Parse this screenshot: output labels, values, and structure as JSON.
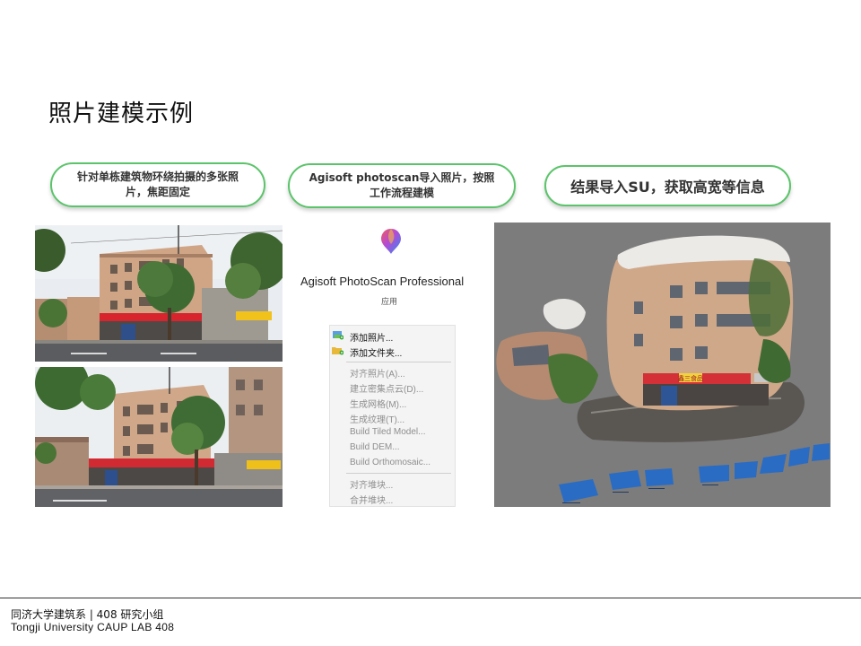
{
  "title": "照片建模示例",
  "steps": [
    {
      "line1": "针对单栋建筑物环绕拍摄的多张照",
      "line2": "片，焦距固定"
    },
    {
      "line1": "Agisoft photoscan导入照片，按照",
      "line2": "工作流程建模"
    },
    {
      "line1": "结果导入SU，获取高宽等信息"
    }
  ],
  "app": {
    "name": "Agisoft PhotoScan Professional",
    "subtitle": "应用"
  },
  "menu": {
    "items": [
      {
        "label": "添加照片...",
        "enabled": true,
        "icon": "add-photo-icon"
      },
      {
        "label": "添加文件夹...",
        "enabled": true,
        "icon": "add-folder-icon"
      },
      {
        "label": "对齐照片(A)...",
        "enabled": false
      },
      {
        "label": "建立密集点云(D)...",
        "enabled": false
      },
      {
        "label": "生成网格(M)...",
        "enabled": false
      },
      {
        "label": "生成纹理(T)...",
        "enabled": false
      },
      {
        "label": "Build Tiled Model...",
        "enabled": false
      },
      {
        "label": "Build DEM...",
        "enabled": false
      },
      {
        "label": "Build Orthomosaic...",
        "enabled": false
      },
      {
        "label": "对齐堆块...",
        "enabled": false
      },
      {
        "label": "合并堆块...",
        "enabled": false
      }
    ]
  },
  "photos": {
    "shop_signs": [
      "鑫三食品"
    ]
  },
  "footer": {
    "line1": "同济大学建筑系 | 408 研究小组",
    "line2": "Tongji  University  CAUP  LAB 408"
  },
  "colors": {
    "pill_border": "#5bc46a",
    "model_background": "#7c7c7c",
    "camera_marker": "#2a6cc4"
  }
}
